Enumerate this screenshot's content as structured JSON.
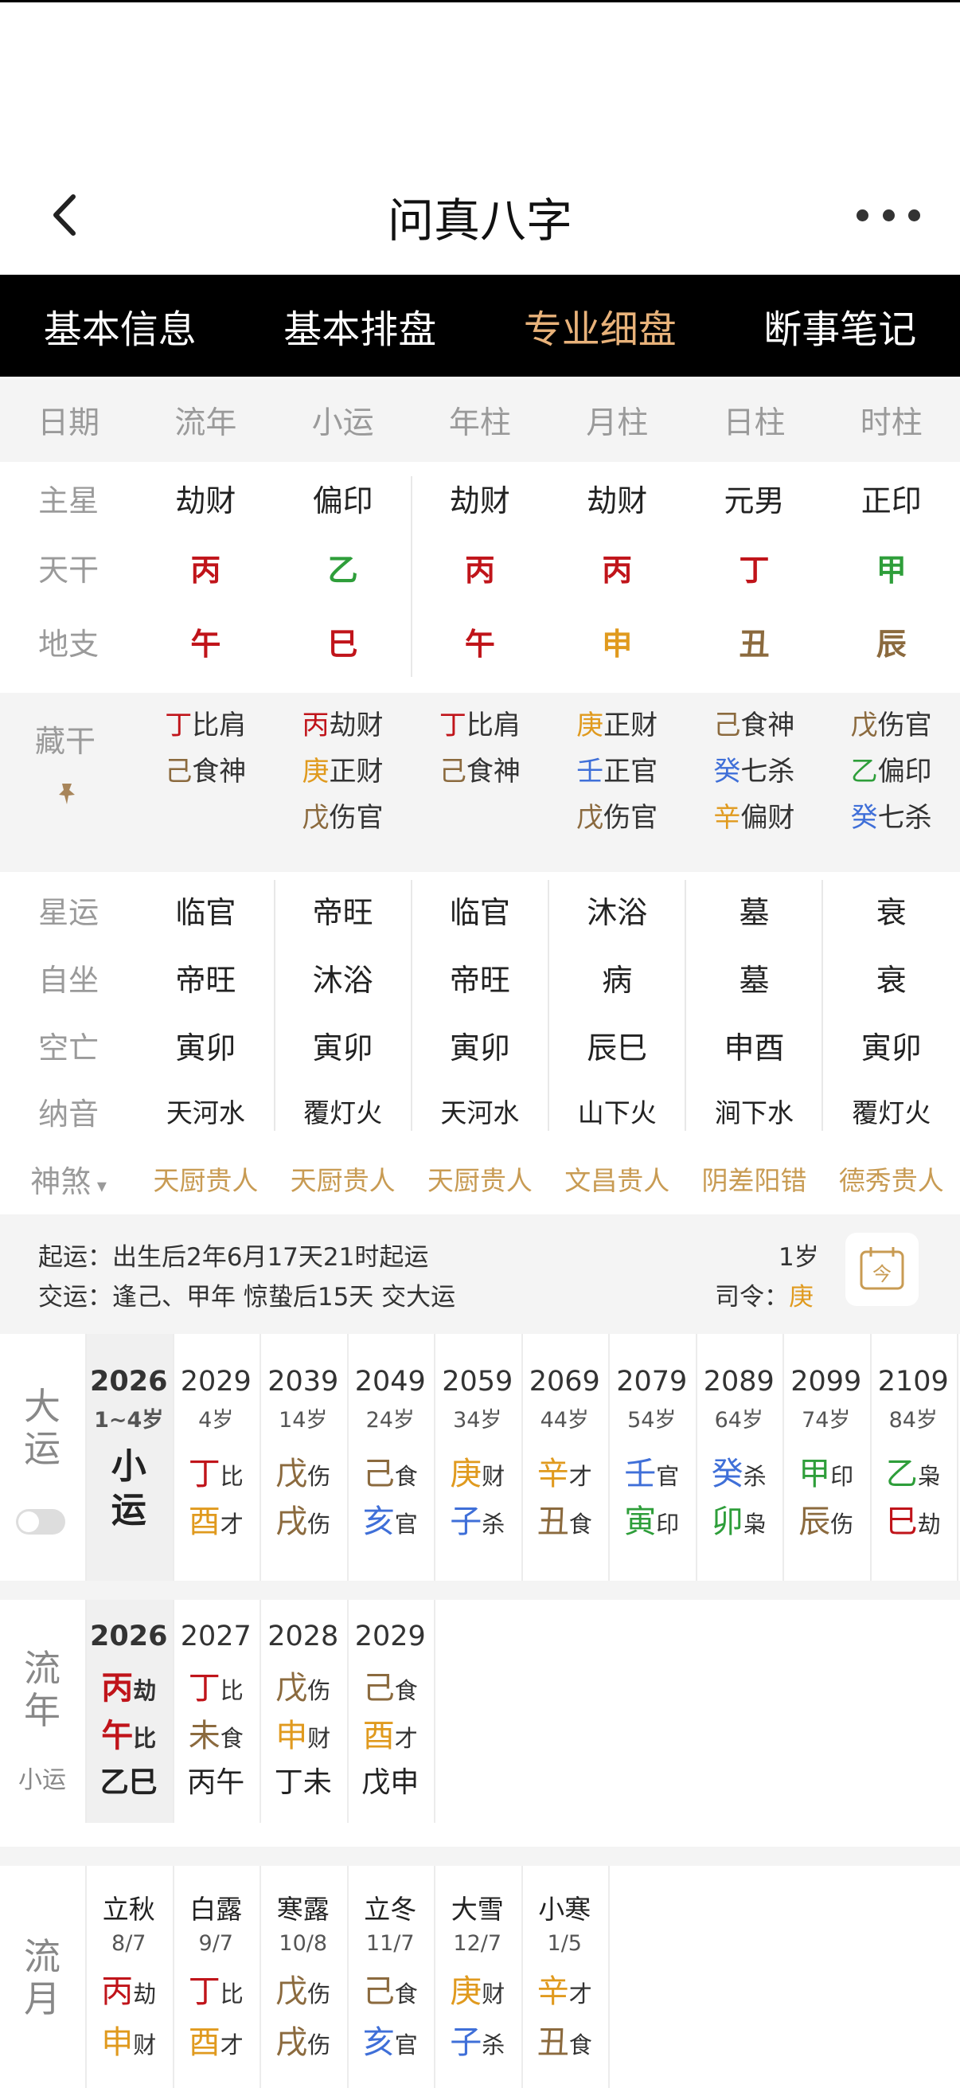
{
  "app_title": "问真八字",
  "tabs": [
    "基本信息",
    "基本排盘",
    "专业细盘",
    "断事笔记"
  ],
  "active_tab": 2,
  "columns": [
    "日期",
    "流年",
    "小运",
    "年柱",
    "月柱",
    "日柱",
    "时柱"
  ],
  "zhuxing": {
    "label": "主星",
    "values": [
      "劫财",
      "偏印",
      "劫财",
      "劫财",
      "元男",
      "正印"
    ]
  },
  "tiangan": {
    "label": "天干",
    "values": [
      "丙",
      "乙",
      "丙",
      "丙",
      "丁",
      "甲"
    ]
  },
  "dizhi": {
    "label": "地支",
    "values": [
      "午",
      "巳",
      "午",
      "申",
      "丑",
      "辰"
    ]
  },
  "canggan": {
    "label": "藏干",
    "cols": [
      [
        [
          "丁",
          "比肩"
        ],
        [
          "己",
          "食神"
        ]
      ],
      [
        [
          "丙",
          "劫财"
        ],
        [
          "庚",
          "正财"
        ],
        [
          "戊",
          "伤官"
        ]
      ],
      [
        [
          "丁",
          "比肩"
        ],
        [
          "己",
          "食神"
        ]
      ],
      [
        [
          "庚",
          "正财"
        ],
        [
          "壬",
          "正官"
        ],
        [
          "戊",
          "伤官"
        ]
      ],
      [
        [
          "己",
          "食神"
        ],
        [
          "癸",
          "七杀"
        ],
        [
          "辛",
          "偏财"
        ]
      ],
      [
        [
          "戊",
          "伤官"
        ],
        [
          "乙",
          "偏印"
        ],
        [
          "癸",
          "七杀"
        ]
      ]
    ]
  },
  "xingyun": {
    "label": "星运",
    "values": [
      "临官",
      "帝旺",
      "临官",
      "沐浴",
      "墓",
      "衰"
    ]
  },
  "zizuo": {
    "label": "自坐",
    "values": [
      "帝旺",
      "沐浴",
      "帝旺",
      "病",
      "墓",
      "衰"
    ]
  },
  "kongwang": {
    "label": "空亡",
    "values": [
      "寅卯",
      "寅卯",
      "寅卯",
      "辰巳",
      "申酉",
      "寅卯"
    ]
  },
  "nayin": {
    "label": "纳音",
    "values": [
      "天河水",
      "覆灯火",
      "天河水",
      "山下火",
      "涧下水",
      "覆灯火"
    ]
  },
  "shensha": {
    "label": "神煞",
    "values": [
      "天厨贵人",
      "天厨贵人",
      "天厨贵人",
      "文昌贵人",
      "阴差阳错",
      "德秀贵人"
    ]
  },
  "qiyun": {
    "line1": "起运：出生后2年6月17天21时起运",
    "line2": "交运：逢己、甲年 惊蛰后15天 交大运",
    "age": "1岁",
    "siling_label": "司令：",
    "siling_value": "庚",
    "cal_icon_text": "今"
  },
  "dayun": {
    "title": [
      "大",
      "运"
    ],
    "first": {
      "year": "2026",
      "age": "1~4岁",
      "text": [
        "小",
        "运"
      ]
    },
    "items": [
      {
        "year": "2029",
        "age": "4岁",
        "g": "丁",
        "gs": "比",
        "z": "酉",
        "zs": "才"
      },
      {
        "year": "2039",
        "age": "14岁",
        "g": "戊",
        "gs": "伤",
        "z": "戌",
        "zs": "伤"
      },
      {
        "year": "2049",
        "age": "24岁",
        "g": "己",
        "gs": "食",
        "z": "亥",
        "zs": "官"
      },
      {
        "year": "2059",
        "age": "34岁",
        "g": "庚",
        "gs": "财",
        "z": "子",
        "zs": "杀"
      },
      {
        "year": "2069",
        "age": "44岁",
        "g": "辛",
        "gs": "才",
        "z": "丑",
        "zs": "食"
      },
      {
        "year": "2079",
        "age": "54岁",
        "g": "壬",
        "gs": "官",
        "z": "寅",
        "zs": "印"
      },
      {
        "year": "2089",
        "age": "64岁",
        "g": "癸",
        "gs": "杀",
        "z": "卯",
        "zs": "枭"
      },
      {
        "year": "2099",
        "age": "74岁",
        "g": "甲",
        "gs": "印",
        "z": "辰",
        "zs": "伤"
      },
      {
        "year": "2109",
        "age": "84岁",
        "g": "乙",
        "gs": "枭",
        "z": "巳",
        "zs": "劫"
      }
    ]
  },
  "liunian": {
    "title": [
      "流",
      "年"
    ],
    "subtitle": "小运",
    "items": [
      {
        "year": "2026",
        "g": "丙",
        "gs": "劫",
        "z": "午",
        "zs": "比",
        "xy": "乙巳"
      },
      {
        "year": "2027",
        "g": "丁",
        "gs": "比",
        "z": "未",
        "zs": "食",
        "xy": "丙午"
      },
      {
        "year": "2028",
        "g": "戊",
        "gs": "伤",
        "z": "申",
        "zs": "财",
        "xy": "丁未"
      },
      {
        "year": "2029",
        "g": "己",
        "gs": "食",
        "z": "酉",
        "zs": "才",
        "xy": "戊申"
      }
    ]
  },
  "liuyue": {
    "title": [
      "流",
      "月"
    ],
    "items": [
      {
        "term": "立秋",
        "date": "8/7",
        "g": "丙",
        "gs": "劫",
        "z": "申",
        "zs": "财"
      },
      {
        "term": "白露",
        "date": "9/7",
        "g": "丁",
        "gs": "比",
        "z": "酉",
        "zs": "才"
      },
      {
        "term": "寒露",
        "date": "10/8",
        "g": "戊",
        "gs": "伤",
        "z": "戌",
        "zs": "伤"
      },
      {
        "term": "立冬",
        "date": "11/7",
        "g": "己",
        "gs": "食",
        "z": "亥",
        "zs": "官"
      },
      {
        "term": "大雪",
        "date": "12/7",
        "g": "庚",
        "gs": "财",
        "z": "子",
        "zs": "杀"
      },
      {
        "term": "小寒",
        "date": "1/5",
        "g": "辛",
        "gs": "才",
        "z": "丑",
        "zs": "食"
      }
    ]
  },
  "colors": {
    "丙": "#c0141a",
    "丁": "#c0141a",
    "午": "#c0141a",
    "巳": "#c0141a",
    "乙": "#2e9e3a",
    "甲": "#2e9e3a",
    "寅": "#2e9e3a",
    "卯": "#2e9e3a",
    "庚": "#e09a1e",
    "辛": "#e09a1e",
    "申": "#e09a1e",
    "酉": "#e09a1e",
    "戊": "#8b6a3e",
    "己": "#8b6a3e",
    "丑": "#8b6a3e",
    "辰": "#8b6a3e",
    "未": "#8b6a3e",
    "戌": "#8b6a3e",
    "壬": "#3f6fd8",
    "癸": "#3f6fd8",
    "子": "#3f6fd8",
    "亥": "#3f6fd8",
    "tab_active": "#e8b27a",
    "shensha": "#c89b53"
  }
}
